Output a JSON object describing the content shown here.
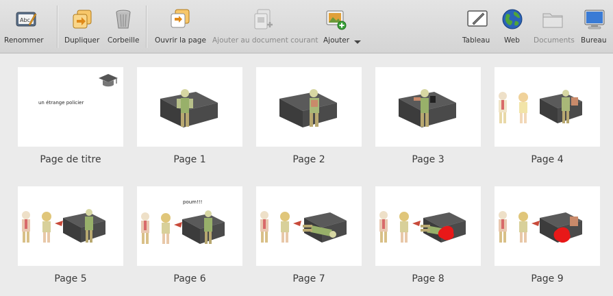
{
  "toolbar": {
    "rename": "Renommer",
    "duplicate": "Dupliquer",
    "trash": "Corbeille",
    "open_page": "Ouvrir la page",
    "add_to_current": "Ajouter au document courant",
    "add": "Ajouter",
    "board": "Tableau",
    "web": "Web",
    "documents": "Documents",
    "desktop": "Bureau"
  },
  "pages": [
    {
      "caption": "Page de titre",
      "text": "un étrange policier"
    },
    {
      "caption": "Page 1"
    },
    {
      "caption": "Page 2"
    },
    {
      "caption": "Page 3"
    },
    {
      "caption": "Page 4"
    },
    {
      "caption": "Page 5"
    },
    {
      "caption": "Page 6",
      "text": "poum!!!"
    },
    {
      "caption": "Page 7"
    },
    {
      "caption": "Page 8"
    },
    {
      "caption": "Page 9"
    }
  ]
}
